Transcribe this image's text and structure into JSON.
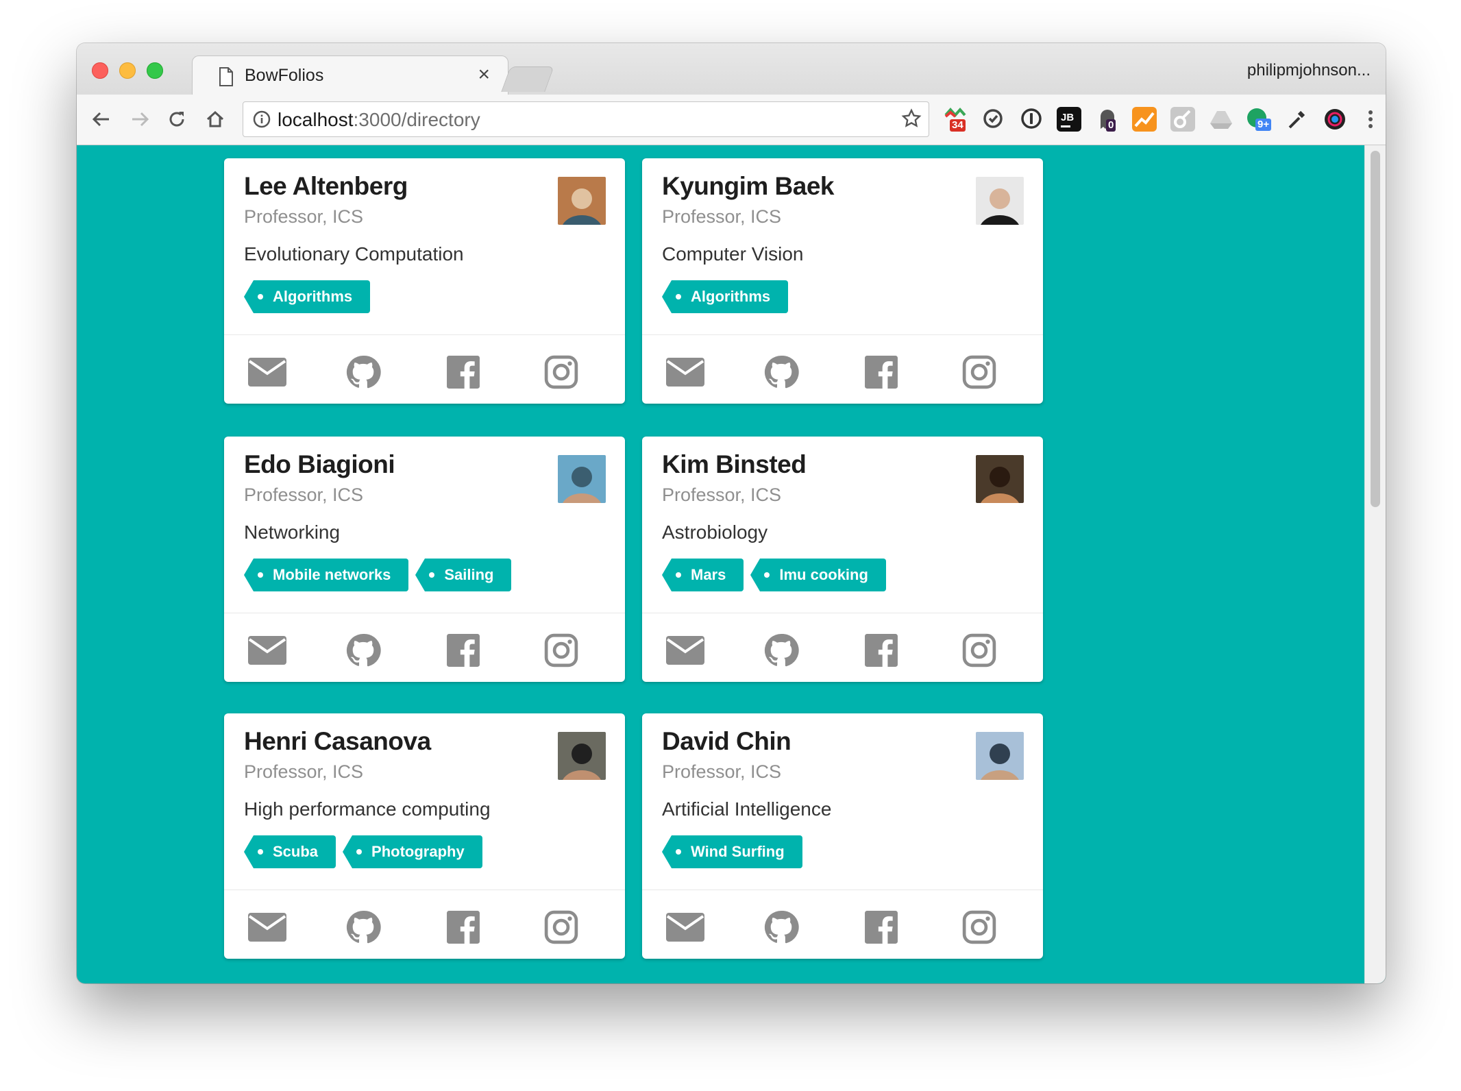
{
  "browser": {
    "tab_title": "BowFolios",
    "tab_close": "×",
    "profile_name": "philipmjohnson...",
    "url_host": "localhost",
    "url_path": ":3000/directory",
    "extension_badges": {
      "calendar": "34",
      "ghost": "0",
      "notifications": "9+"
    }
  },
  "theme": {
    "background": "#00b3ad",
    "tag_color": "#00b3ad",
    "icon_color": "#8c8c8c"
  },
  "profiles": [
    {
      "name": "Lee Altenberg",
      "title": "Professor, ICS",
      "interest": "Evolutionary Computation",
      "tags": [
        "Algorithms"
      ]
    },
    {
      "name": "Kyungim Baek",
      "title": "Professor, ICS",
      "interest": "Computer Vision",
      "tags": [
        "Algorithms"
      ]
    },
    {
      "name": "Edo Biagioni",
      "title": "Professor, ICS",
      "interest": "Networking",
      "tags": [
        "Mobile networks",
        "Sailing"
      ]
    },
    {
      "name": "Kim Binsted",
      "title": "Professor, ICS",
      "interest": "Astrobiology",
      "tags": [
        "Mars",
        "Imu cooking"
      ]
    },
    {
      "name": "Henri Casanova",
      "title": "Professor, ICS",
      "interest": "High performance computing",
      "tags": [
        "Scuba",
        "Photography"
      ]
    },
    {
      "name": "David Chin",
      "title": "Professor, ICS",
      "interest": "Artificial Intelligence",
      "tags": [
        "Wind Surfing"
      ]
    }
  ],
  "social_icons": [
    "envelope-icon",
    "github-icon",
    "facebook-icon",
    "instagram-icon"
  ]
}
